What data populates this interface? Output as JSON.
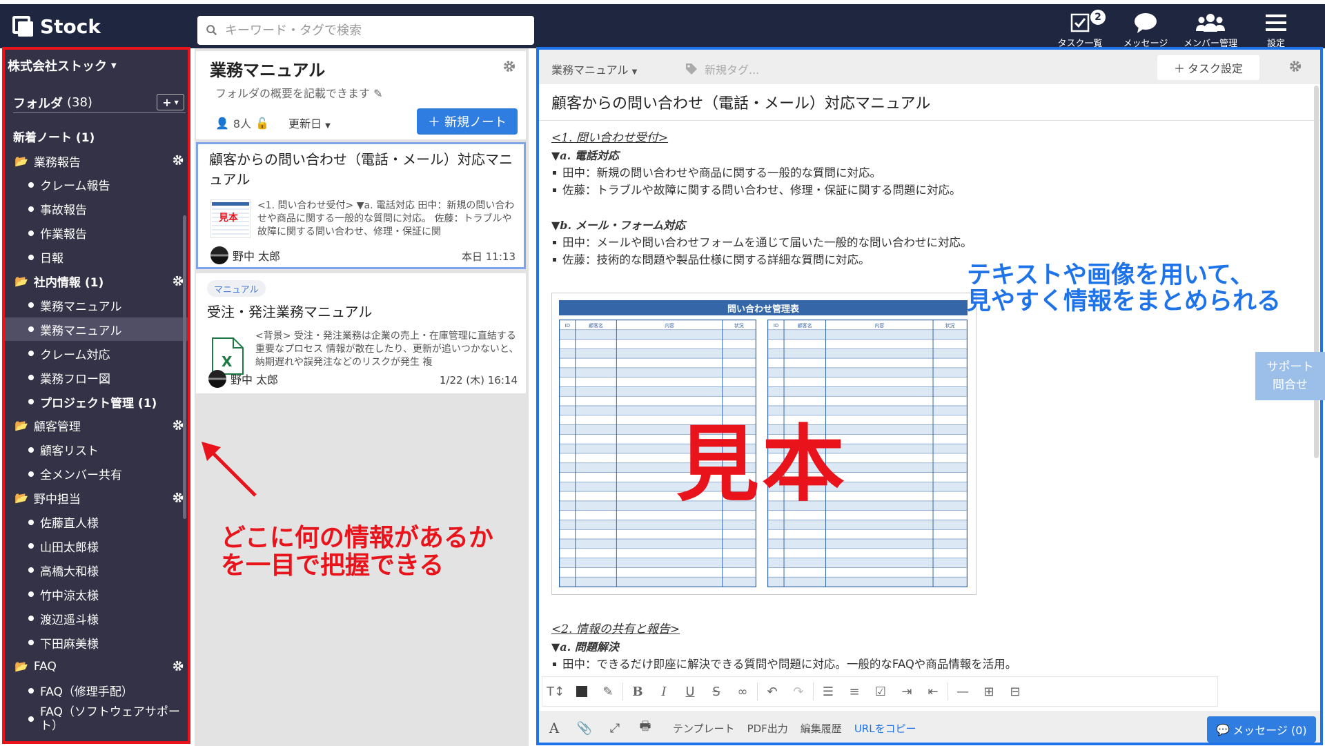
{
  "app": {
    "name": "Stock"
  },
  "search": {
    "placeholder": "キーワード・タグで検索"
  },
  "topnav": [
    {
      "label": "タスク一覧",
      "icon": "task-check-icon",
      "badge": "2"
    },
    {
      "label": "メッセージ",
      "icon": "message-bubble-icon"
    },
    {
      "label": "メンバー管理",
      "icon": "members-icon"
    },
    {
      "label": "設定",
      "icon": "hamburger-menu-icon"
    }
  ],
  "sidebar": {
    "company": "株式会社ストック",
    "folders_label": "フォルダ",
    "folders_count": "(38)",
    "add_label": "+",
    "new_notes": "新着ノート (1)",
    "items": [
      {
        "label": "業務報告",
        "type": "folder",
        "gear": true
      },
      {
        "label": "クレーム報告",
        "type": "sub"
      },
      {
        "label": "事故報告",
        "type": "sub"
      },
      {
        "label": "作業報告",
        "type": "sub"
      },
      {
        "label": "日報",
        "type": "sub"
      },
      {
        "label": "社内情報 (1)",
        "type": "folder",
        "gear": true,
        "bold": true
      },
      {
        "label": "業務マニュアル",
        "type": "sub"
      },
      {
        "label": "業務マニュアル",
        "type": "sub",
        "active": true
      },
      {
        "label": "クレーム対応",
        "type": "sub"
      },
      {
        "label": "業務フロー図",
        "type": "sub"
      },
      {
        "label": "プロジェクト管理 (1)",
        "type": "sub",
        "bold": true
      },
      {
        "label": "顧客管理",
        "type": "folder",
        "gear": true
      },
      {
        "label": "顧客リスト",
        "type": "sub"
      },
      {
        "label": "全メンバー共有",
        "type": "sub"
      },
      {
        "label": "野中担当",
        "type": "folder",
        "gear": true
      },
      {
        "label": "佐藤直人様",
        "type": "sub"
      },
      {
        "label": "山田太郎様",
        "type": "sub"
      },
      {
        "label": "高橋大和様",
        "type": "sub"
      },
      {
        "label": "竹中涼太様",
        "type": "sub"
      },
      {
        "label": "渡辺遥斗様",
        "type": "sub"
      },
      {
        "label": "下田麻美様",
        "type": "sub"
      },
      {
        "label": "FAQ",
        "type": "folder",
        "gear": true
      },
      {
        "label": "FAQ（修理手配）",
        "type": "sub"
      },
      {
        "label": "FAQ（ソフトウェアサポート）",
        "type": "sub"
      }
    ]
  },
  "folder_panel": {
    "title": "業務マニュアル",
    "description": "フォルダの概要を記載できます",
    "members": "8人",
    "sort_label": "更新日",
    "new_note_label": "新規ノート"
  },
  "notes": [
    {
      "title": "顧客からの問い合わせ（電話・メール）対応マニュアル",
      "thumb_label": "見本",
      "excerpt": "<1. 問い合わせ受付> ▼a. 電話対応 田中：新規の問い合わせや商品に関する一般的な質問に対応。 佐藤：トラブルや故障に関する問い合わせ、修理・保証に関",
      "author": "野中 太郎",
      "date": "本日 11:13"
    },
    {
      "tag": "マニュアル",
      "title": "受注・発注業務マニュアル",
      "thumb_label": "X",
      "excerpt": "<背景> 受注・発注業務は企業の売上・在庫管理に直結する重要なプロセス 情報が散在したり、更新が追いつかないと、納期遅れや誤発注などのリスクが発生 複",
      "author": "野中 太郎",
      "date": "1/22 (木) 16:14"
    }
  ],
  "note": {
    "folder": "業務マニュアル",
    "tag_placeholder": "新規タグ...",
    "task_button": "タスク設定",
    "title": "顧客からの問い合わせ（電話・メール）対応マニュアル",
    "s1": "<1. 問い合わせ受付>",
    "s1a": "▼a. 電話対応",
    "s1a1": "田中：新規の問い合わせや商品に関する一般的な質問に対応。",
    "s1a2": "佐藤：トラブルや故障に関する問い合わせ、修理・保証に関する問題に対応。",
    "s1b": "▼b. メール・フォーム対応",
    "s1b1": "田中：メールや問い合わせフォームを通じて届いた一般的な問い合わせに対応。",
    "s1b2": "佐藤：技術的な問題や製品仕様に関する詳細な質問に対応。",
    "sheet_title": "問い合わせ管理表",
    "sheet_cols": [
      "ID",
      "顧客名",
      "内容",
      "状況"
    ],
    "sheet_stamp": "見本",
    "s2": "<2. 情報の共有と報告>",
    "s2a": "▼a. 問題解決",
    "s2a1": "田中：できるだけ即座に解決できる質問や問題に対応。一般的なFAQや商品情報を活用。"
  },
  "footer": {
    "template": "テンプレート",
    "pdf": "PDF出力",
    "history": "編集履歴",
    "copy_url": "URLをコピー",
    "message_button": "メッセージ (0)"
  },
  "support": {
    "line1": "サポート",
    "line2": "問合せ"
  },
  "callouts": {
    "right_line1": "テキストや画像を用いて、",
    "right_line2": "見やすく情報をまとめられる",
    "left_line1": "どこに何の情報があるか",
    "left_line2": "を一目で把握できる"
  },
  "colors": {
    "header_bg": "#1f2740",
    "sidebar_bg": "#333246",
    "accent_blue": "#2f7de1",
    "highlight_red": "#e8131b"
  }
}
